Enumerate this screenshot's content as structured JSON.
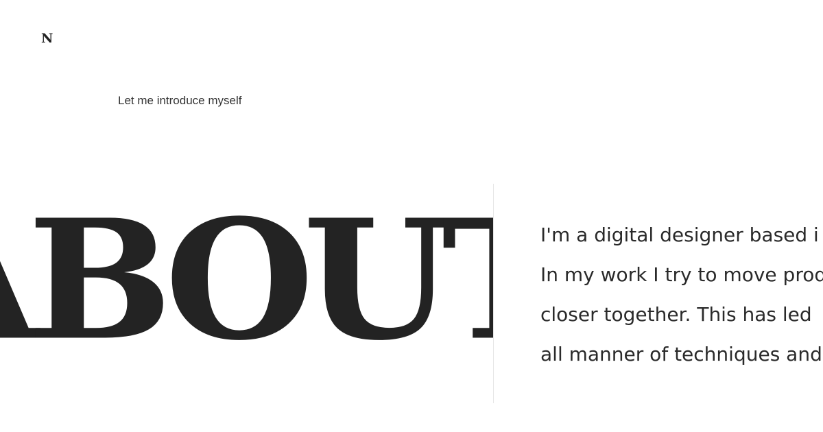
{
  "brand": {
    "logo_letter": "N"
  },
  "intro": {
    "text": "Let me introduce myself"
  },
  "hero": {
    "word": "ABOUT"
  },
  "bio": {
    "lines": [
      "I'm a digital designer based i",
      "In my work I try to move prod",
      "closer together. This has led",
      "all manner of techniques and"
    ]
  },
  "colors": {
    "background": "#ffffff",
    "text": "#222222",
    "divider": "#e6e6e6"
  }
}
